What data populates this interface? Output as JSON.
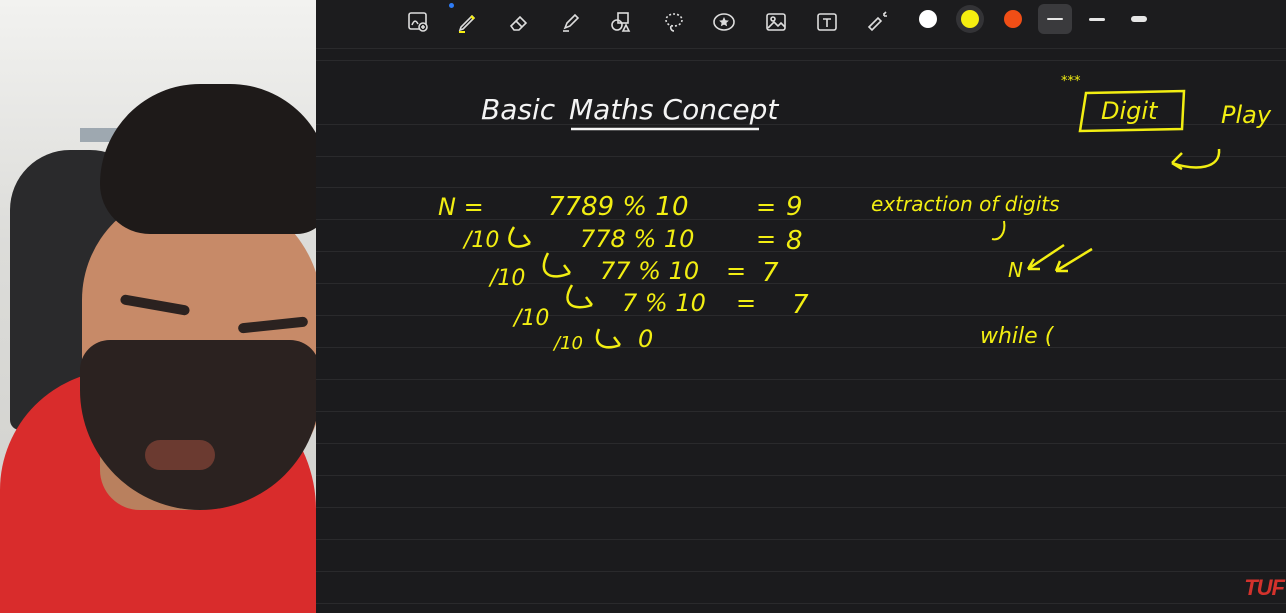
{
  "toolbar": {
    "tools": [
      {
        "name": "zoom-tool",
        "icon": "image-zoom-icon"
      },
      {
        "name": "pen-tool",
        "icon": "pen-icon"
      },
      {
        "name": "eraser-tool",
        "icon": "eraser-icon"
      },
      {
        "name": "highlighter-tool",
        "icon": "highlighter-icon"
      },
      {
        "name": "shapes-tool",
        "icon": "shapes-icon"
      },
      {
        "name": "lasso-tool",
        "icon": "lasso-icon"
      },
      {
        "name": "sticker-tool",
        "icon": "star-sticker-icon"
      },
      {
        "name": "image-tool",
        "icon": "image-icon"
      },
      {
        "name": "text-tool",
        "icon": "text-box-icon"
      },
      {
        "name": "laser-tool",
        "icon": "laser-pointer-icon"
      }
    ],
    "colors": [
      "#ffffff",
      "#f5ee10",
      "#f04e16"
    ],
    "selected_color": "#f5ee10",
    "stroke_widths": [
      "thin",
      "medium",
      "thick"
    ],
    "selected_stroke": "thin"
  },
  "notes": {
    "title_plain": "Basic",
    "title_underlined": "Maths Concept",
    "box_label": "Digit",
    "box_stars": "***",
    "play_label": "Play",
    "lines": [
      {
        "lhs": "N =",
        "expr": "7789 % 10",
        "eq": "=",
        "res": "9"
      },
      {
        "lhs": "/10",
        "expr": "778 % 10",
        "eq": "=",
        "res": "8"
      },
      {
        "lhs": "/10",
        "expr": "77 % 10",
        "eq": "=",
        "res": "7"
      },
      {
        "lhs": "/10",
        "expr": "7 % 10",
        "eq": "=",
        "res": "7"
      },
      {
        "lhs": "/10",
        "expr": "0",
        "eq": "",
        "res": ""
      }
    ],
    "extraction_label": "extraction of digits",
    "n_arrow_label": "N",
    "while_label": "while ("
  },
  "watermark": "TUF"
}
